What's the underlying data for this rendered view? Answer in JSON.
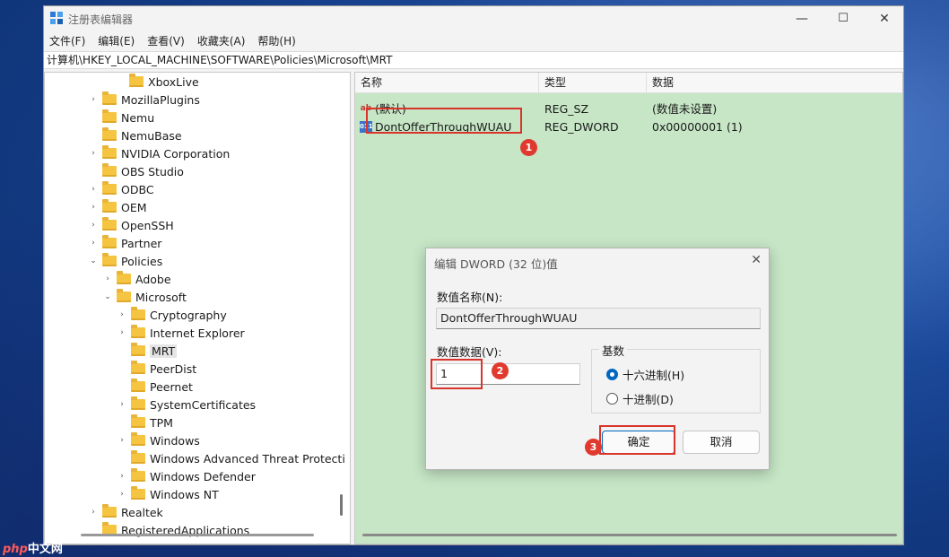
{
  "window": {
    "title": "注册表编辑器",
    "minimize": "—",
    "maximize": "☐",
    "close": "✕"
  },
  "menu": [
    "文件(F)",
    "编辑(E)",
    "查看(V)",
    "收藏夹(A)",
    "帮助(H)"
  ],
  "address": "计算机\\HKEY_LOCAL_MACHINE\\SOFTWARE\\Policies\\Microsoft\\MRT",
  "tree": [
    {
      "label": "XboxLive",
      "chev": ""
    },
    {
      "label": "MozillaPlugins",
      "chev": "›"
    },
    {
      "label": "Nemu",
      "chev": ""
    },
    {
      "label": "NemuBase",
      "chev": ""
    },
    {
      "label": "NVIDIA Corporation",
      "chev": "›"
    },
    {
      "label": "OBS Studio",
      "chev": ""
    },
    {
      "label": "ODBC",
      "chev": "›"
    },
    {
      "label": "OEM",
      "chev": "›"
    },
    {
      "label": "OpenSSH",
      "chev": "›"
    },
    {
      "label": "Partner",
      "chev": "›"
    },
    {
      "label": "Policies",
      "chev": "⌄"
    },
    {
      "label": "Adobe",
      "chev": "›"
    },
    {
      "label": "Microsoft",
      "chev": "⌄"
    },
    {
      "label": "Cryptography",
      "chev": "›"
    },
    {
      "label": "Internet Explorer",
      "chev": "›"
    },
    {
      "label": "MRT",
      "chev": ""
    },
    {
      "label": "PeerDist",
      "chev": ""
    },
    {
      "label": "Peernet",
      "chev": ""
    },
    {
      "label": "SystemCertificates",
      "chev": "›"
    },
    {
      "label": "TPM",
      "chev": ""
    },
    {
      "label": "Windows",
      "chev": "›"
    },
    {
      "label": "Windows Advanced Threat Protecti",
      "chev": ""
    },
    {
      "label": "Windows Defender",
      "chev": "›"
    },
    {
      "label": "Windows NT",
      "chev": "›"
    },
    {
      "label": "Realtek",
      "chev": "›"
    },
    {
      "label": "RegisteredApplications",
      "chev": ""
    }
  ],
  "values": {
    "headers": {
      "name": "名称",
      "type": "类型",
      "data": "数据"
    },
    "rows": [
      {
        "name": "(默认)",
        "type": "REG_SZ",
        "data": "(数值未设置)",
        "icon": "ab"
      },
      {
        "name": "DontOfferThroughWUAU",
        "type": "REG_DWORD",
        "data": "0x00000001 (1)",
        "icon": "011"
      }
    ]
  },
  "dialog": {
    "title": "编辑 DWORD (32 位)值",
    "close": "✕",
    "name_label": "数值名称(N):",
    "name_value": "DontOfferThroughWUAU",
    "data_label": "数值数据(V):",
    "data_value": "1",
    "base_label": "基数",
    "hex_label": "十六进制(H)",
    "dec_label": "十进制(D)",
    "ok_label": "确定",
    "cancel_label": "取消"
  },
  "badges": [
    "1",
    "2",
    "3"
  ],
  "watermark": {
    "logo": "php",
    "text": "中文网"
  },
  "colors": {
    "highlight": "#d9342b",
    "values_bg": "#c6e6c6",
    "accent": "#0067c0"
  }
}
